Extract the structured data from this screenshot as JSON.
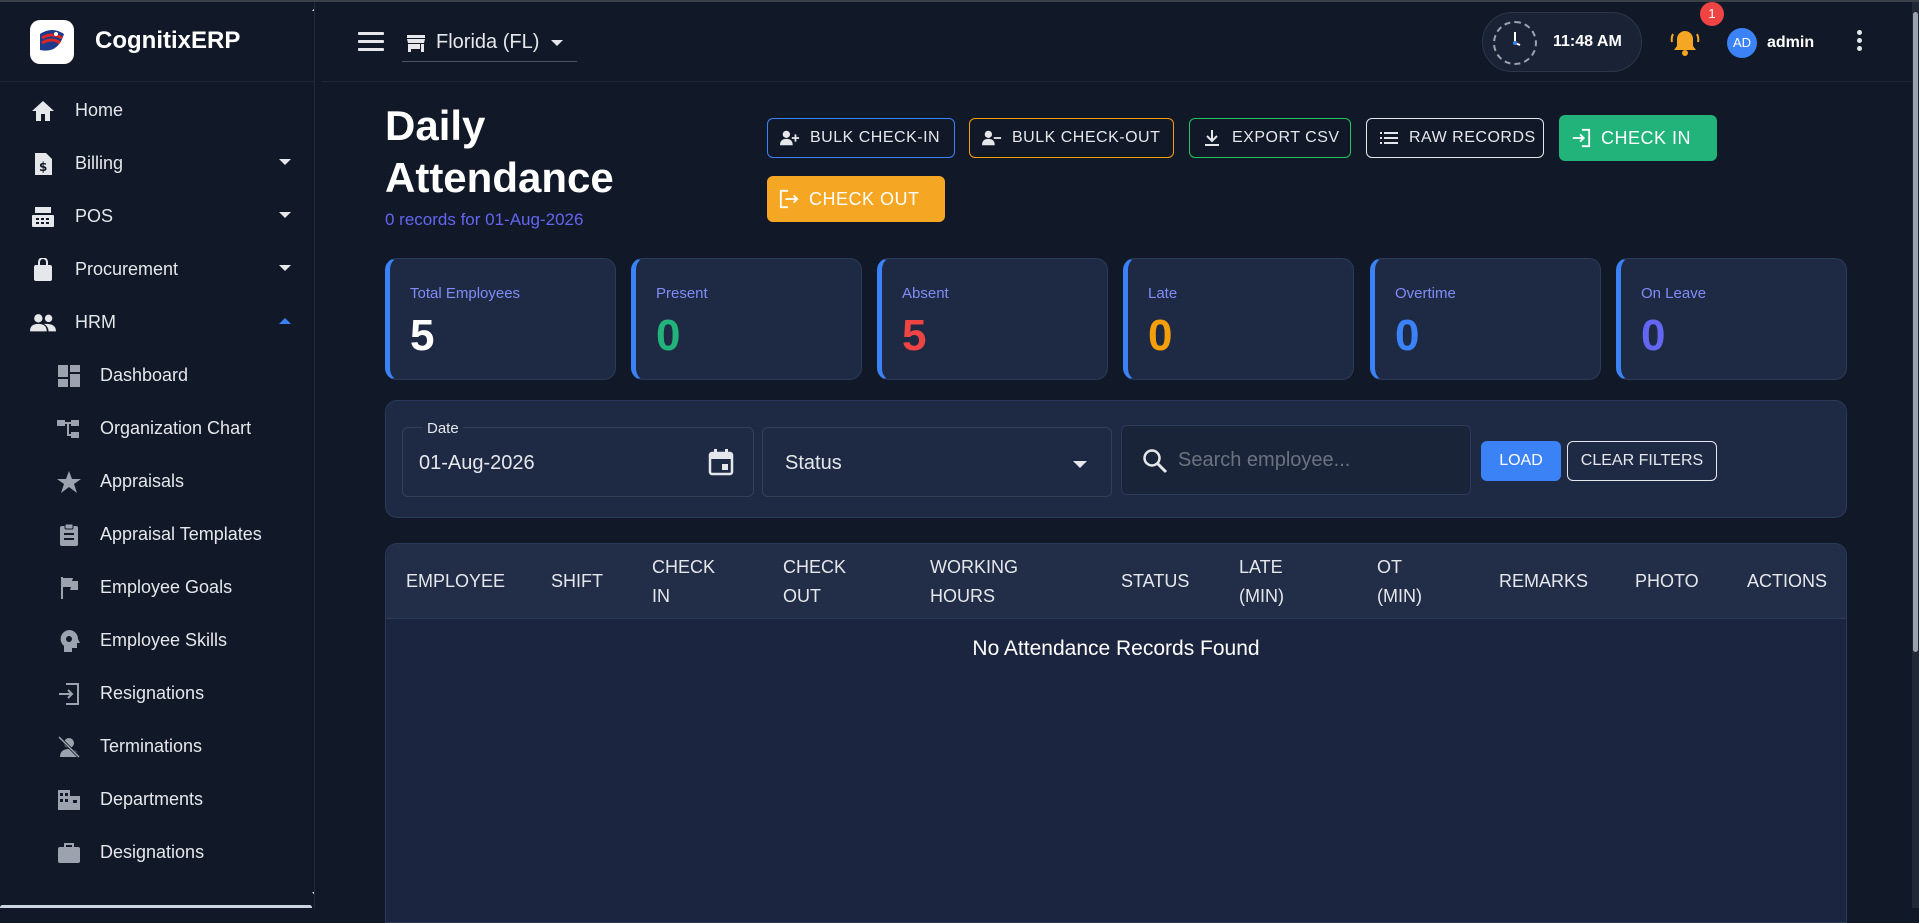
{
  "app": {
    "name": "CognitixERP"
  },
  "sidebar": {
    "items": [
      {
        "label": "Home",
        "icon": "home-icon"
      },
      {
        "label": "Billing",
        "icon": "billing-icon"
      },
      {
        "label": "POS",
        "icon": "pos-icon"
      },
      {
        "label": "Procurement",
        "icon": "procurement-icon"
      },
      {
        "label": "HRM",
        "icon": "people-icon"
      }
    ],
    "hrm_sub": [
      {
        "label": "Dashboard"
      },
      {
        "label": "Organization Chart"
      },
      {
        "label": "Appraisals"
      },
      {
        "label": "Appraisal Templates"
      },
      {
        "label": "Employee Goals"
      },
      {
        "label": "Employee Skills"
      },
      {
        "label": "Resignations"
      },
      {
        "label": "Terminations"
      },
      {
        "label": "Departments"
      },
      {
        "label": "Designations"
      }
    ]
  },
  "topbar": {
    "store": "Florida (FL)",
    "time": "11:48 AM",
    "notification_count": "1",
    "avatar_initials": "AD",
    "username": "admin"
  },
  "page": {
    "title": "Daily Attendance",
    "subtitle": "0 records for 01-Aug-2026"
  },
  "actions": {
    "bulk_check_in": "BULK CHECK-IN",
    "bulk_check_out": "BULK CHECK-OUT",
    "export_csv": "EXPORT CSV",
    "raw_records": "RAW RECORDS",
    "check_in": "CHECK IN",
    "check_out": "CHECK OUT"
  },
  "stats": [
    {
      "label": "Total Employees",
      "value": "5",
      "color": "#ffffff"
    },
    {
      "label": "Present",
      "value": "0",
      "color": "#22b37b"
    },
    {
      "label": "Absent",
      "value": "5",
      "color": "#ef4444"
    },
    {
      "label": "Late",
      "value": "0",
      "color": "#f59e0b"
    },
    {
      "label": "Overtime",
      "value": "0",
      "color": "#3b82f6"
    },
    {
      "label": "On Leave",
      "value": "0",
      "color": "#6366f1"
    }
  ],
  "filters": {
    "date_label": "Date",
    "date_value": "01-Aug-2026",
    "status_value": "Status",
    "search_placeholder": "Search employee...",
    "load": "LOAD",
    "clear": "CLEAR FILTERS"
  },
  "table": {
    "headers": [
      "EMPLOYEE",
      "SHIFT",
      "CHECK IN",
      "CHECK OUT",
      "WORKING HOURS",
      "STATUS",
      "LATE (MIN)",
      "OT (MIN)",
      "REMARKS",
      "PHOTO",
      "ACTIONS"
    ],
    "empty_text": "No Attendance Records Found"
  },
  "colors": {
    "accent": "#3b82f6",
    "green": "#22b37b",
    "orange": "#f5a623",
    "bg": "#111827"
  }
}
